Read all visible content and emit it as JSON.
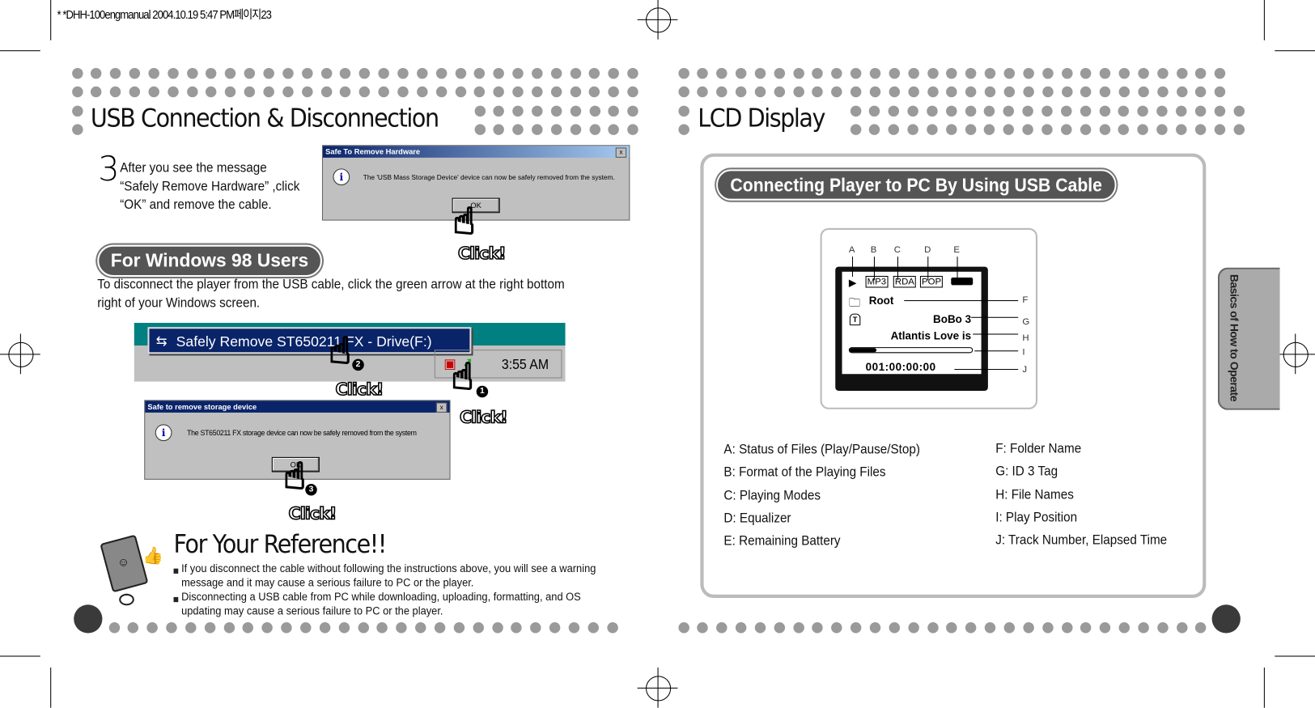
{
  "print_header": "* *DHH-100engmanual  2004.10.19 5:47 PM페이지23",
  "left_page": {
    "title": "USB Connection & Disconnection",
    "step": {
      "number": "3",
      "text_lines": [
        "After you see the message",
        "“Safely Remove Hardware” ,click",
        "“OK” and remove the cable."
      ]
    },
    "dialog1": {
      "title": "Safe To Remove Hardware",
      "close": "x",
      "message": "The 'USB Mass Storage Device' device can now be safely removed from the system.",
      "ok_label": "OK"
    },
    "click_label": "Click!",
    "win98_heading": "For Windows 98 Users",
    "win98_text_lines": [
      "To disconnect the player from the USB cable, click the green arrow at the right bottom",
      "right of your Windows screen."
    ],
    "taskbar": {
      "menu_item": "Safely Remove ST650211 FX - Drive(F:)",
      "clock": "3:55 AM"
    },
    "dialog2": {
      "title": "Safe to remove storage device",
      "close": "x",
      "message": "The ST650211 FX storage device can now be safely removed from the system",
      "ok_label": "OK"
    },
    "step_numbers": [
      "1",
      "2",
      "3"
    ],
    "reference": {
      "title": "For Your Reference!!",
      "items": [
        "If you disconnect the cable without following the instructions above, you will see a warning message and it may cause a serious failure to PC or the player.",
        "Disconnecting a USB cable from PC while downloading, uploading, formatting, and OS updating may cause a serious failure to PC or the player."
      ]
    }
  },
  "right_page": {
    "title": "LCD Display",
    "box_heading": "Connecting Player to PC By Using USB Cable",
    "side_tab": "Basics of How to Operate",
    "lcd": {
      "top_labels": [
        "A",
        "B",
        "C",
        "D",
        "E"
      ],
      "side_labels": [
        "F",
        "G",
        "H",
        "I",
        "J"
      ],
      "badges": [
        "MP3",
        "RDA",
        "POP"
      ],
      "folder": "Root",
      "tag": "BoBo 3",
      "file": "Atlantis Love is",
      "time": "001:00:00:00",
      "progress_percent": 10
    },
    "legend_left": [
      "A:  Status of Files (Play/Pause/Stop)",
      "B:  Format of the Playing Files",
      "C:  Playing Modes",
      "D:  Equalizer",
      "E:  Remaining Battery"
    ],
    "legend_right": [
      "F:  Folder Name",
      "G:  ID 3 Tag",
      "H: File Names",
      "I: Play Position",
      "J: Track Number, Elapsed Time"
    ]
  },
  "colors": {
    "dots": "#9a9a9a",
    "pill": "#555555",
    "titlebar": "#0a246a",
    "teal": "#008080"
  }
}
